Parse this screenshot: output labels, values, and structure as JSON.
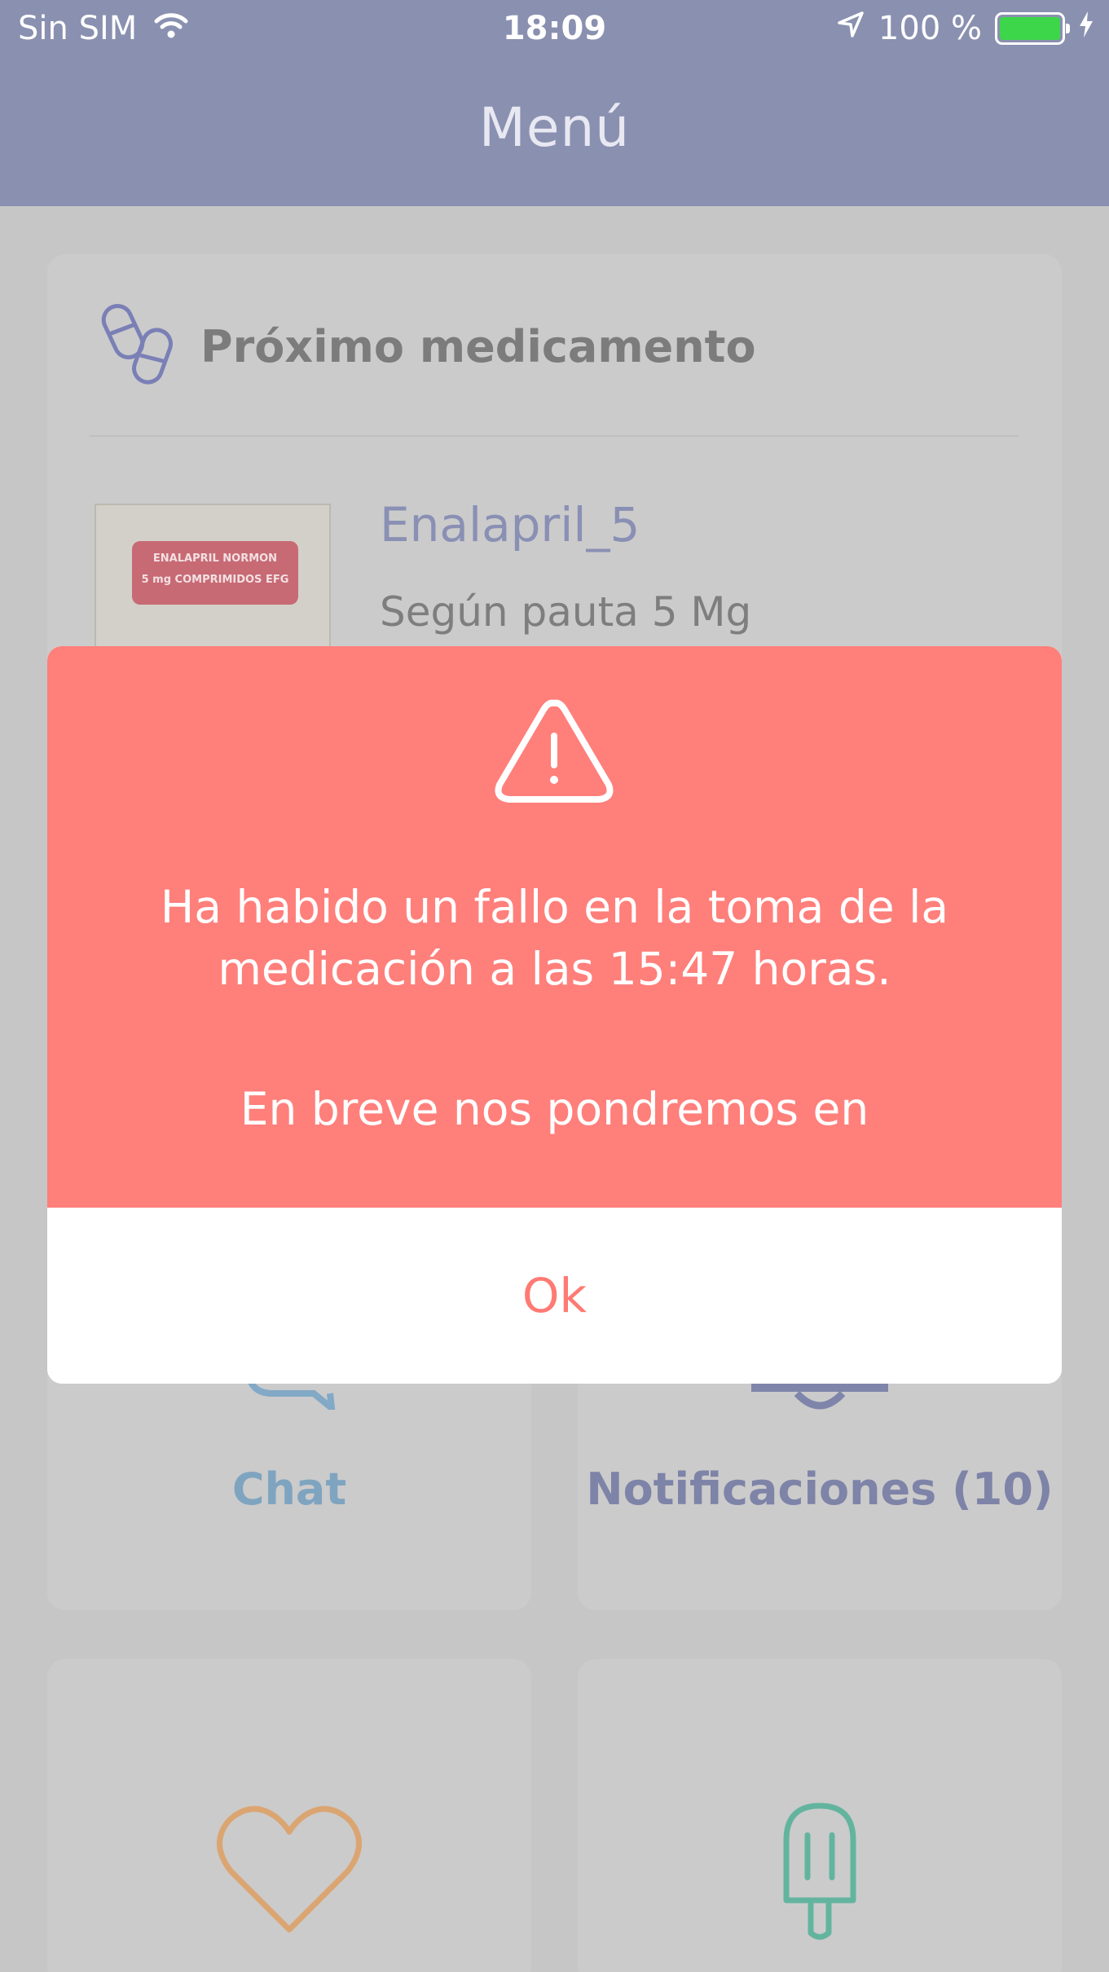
{
  "status_bar": {
    "carrier": "Sin SIM",
    "time": "18:09",
    "battery": "100 %",
    "battery_level": 1.0,
    "icons": [
      "wifi-icon",
      "location-arrow-icon",
      "battery-icon",
      "charging-bolt-icon"
    ]
  },
  "nav": {
    "title": "Menú"
  },
  "next_medication": {
    "title": "Próximo medicamento",
    "name": "Enalapril_5",
    "dose": "Según pauta 5 Mg",
    "package_text_line1": "ENALAPRIL NORMON",
    "package_text_line2": "5 mg COMPRIMIDOS EFG"
  },
  "tiles": {
    "chat": {
      "label": "Chat"
    },
    "notifications": {
      "label": "Notificaciones (10)"
    }
  },
  "alert": {
    "message": "Ha habido un fallo en la toma de la medicación a las 15:47 horas.",
    "message_continued": "En breve nos pondremos en",
    "ok_label": "Ok"
  },
  "colors": {
    "alert_red": "#ff7f7b",
    "ok_text": "#ff7a74",
    "nav_bar": "#8a90b0",
    "battery_green": "#3dd64a"
  }
}
